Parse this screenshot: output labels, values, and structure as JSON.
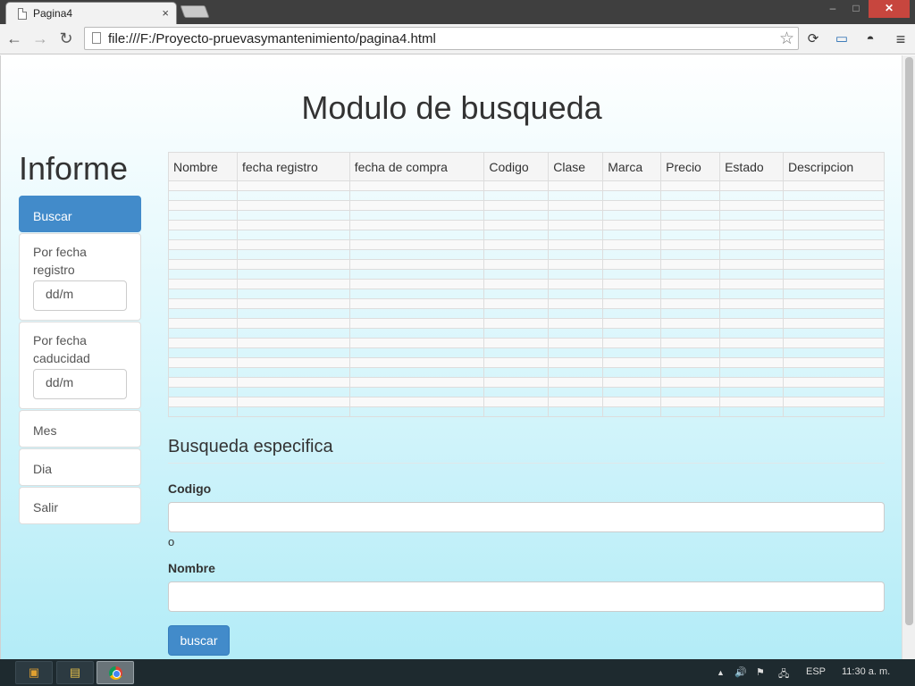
{
  "browser": {
    "tab_title": "Pagina4",
    "tab_close": "×",
    "url": "file:///F:/Proyecto-pruevasymantenimiento/pagina4.html",
    "window_buttons": {
      "minimize": "–",
      "maximize": "□",
      "close": "✕"
    },
    "nav": {
      "back": "←",
      "forward": "→",
      "reload": "↻"
    },
    "star": "☆",
    "menu": "≡"
  },
  "page": {
    "title": "Modulo de busqueda",
    "sidebar": {
      "heading": "Informe",
      "items": [
        {
          "label": "Buscar"
        },
        {
          "label": "Por fecha registro",
          "input_value": "dd/m"
        },
        {
          "label": "Por fecha caducidad",
          "input_value": "dd/m"
        },
        {
          "label": "Mes"
        },
        {
          "label": "Dia"
        },
        {
          "label": "Salir"
        }
      ]
    },
    "table": {
      "columns": [
        "Nombre",
        "fecha registro",
        "fecha de compra",
        "Codigo",
        "Clase",
        "Marca",
        "Precio",
        "Estado",
        "Descripcion"
      ],
      "empty_rows": 24
    },
    "search": {
      "heading": "Busqueda especifica",
      "codigo_label": "Codigo",
      "or_text": "o",
      "nombre_label": "Nombre",
      "codigo_value": "",
      "nombre_value": "",
      "button_label": "buscar"
    }
  },
  "taskbar": {
    "language": "ESP",
    "clock": "11:30 a. m."
  },
  "colors": {
    "primary": "#428bca",
    "gradient_top": "#ffffff",
    "gradient_bottom": "#b3ecf7"
  }
}
